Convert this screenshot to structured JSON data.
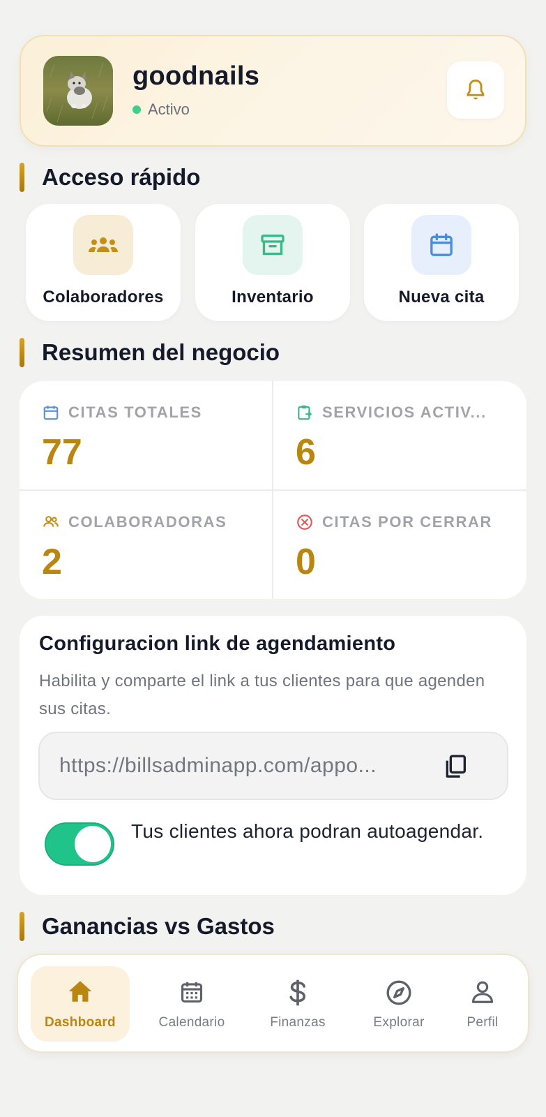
{
  "header": {
    "business_name": "goodnails",
    "status": "Activo",
    "status_color": "#3ecf8e",
    "bell_icon": "bell-icon"
  },
  "quick_access": {
    "title": "Acceso rápido",
    "items": [
      {
        "label": "Colaboradores",
        "icon": "people-icon",
        "bg": "#f7ecd6",
        "color": "#c48f16"
      },
      {
        "label": "Inventario",
        "icon": "archive-box-icon",
        "bg": "#e4f4ee",
        "color": "#3ab88a"
      },
      {
        "label": "Nueva cita",
        "icon": "calendar-icon",
        "bg": "#e6effb",
        "color": "#4a8de0"
      }
    ]
  },
  "summary": {
    "title": "Resumen del negocio",
    "stats": [
      {
        "label": "CITAS TOTALES",
        "value": "77",
        "icon": "calendar-icon",
        "icon_color": "#5b8fd8"
      },
      {
        "label": "SERVICIOS ACTIV...",
        "value": "6",
        "icon": "clipboard-icon",
        "icon_color": "#3ab88a"
      },
      {
        "label": "COLABORADORAS",
        "value": "2",
        "icon": "people-icon",
        "icon_color": "#c48f16"
      },
      {
        "label": "CITAS POR CERRAR",
        "value": "0",
        "icon": "close-circle-icon",
        "icon_color": "#e05a5a"
      }
    ]
  },
  "config": {
    "title": "Configuracion link de agendamiento",
    "description": "Habilita y comparte el link a tus clientes para que agenden sus citas.",
    "link": "https://billsadminapp.com/appo...",
    "toggle_on": true,
    "toggle_text": "Tus clientes ahora podran autoagendar."
  },
  "earnings": {
    "title": "Ganancias vs Gastos"
  },
  "nav": {
    "items": [
      {
        "label": "Dashboard",
        "icon": "home-icon",
        "active": true
      },
      {
        "label": "Calendario",
        "icon": "calendar-icon",
        "active": false
      },
      {
        "label": "Finanzas",
        "icon": "dollar-icon",
        "active": false
      },
      {
        "label": "Explorar",
        "icon": "compass-icon",
        "active": false
      },
      {
        "label": "Perfil",
        "icon": "user-icon",
        "active": false
      }
    ]
  },
  "colors": {
    "accent": "#b9860f",
    "background": "#f2f2f1",
    "toggle": "#20c48a"
  }
}
